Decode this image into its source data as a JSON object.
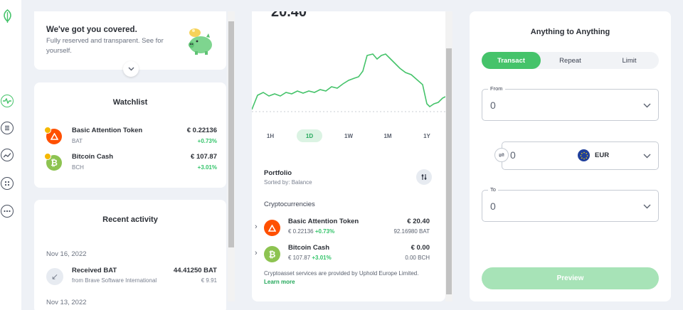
{
  "nav": {
    "icons": [
      "uphold-logo-icon",
      "activity-icon",
      "list-icon",
      "chart-icon",
      "dots-grid-icon",
      "more-icon"
    ]
  },
  "promo": {
    "title": "We've got you covered.",
    "text": "Fully reserved and transparent. See for yourself."
  },
  "watchlist": {
    "title": "Watchlist",
    "items": [
      {
        "name": "Basic Attention Token",
        "symbol": "BAT",
        "price": "€ 0.22136",
        "change": "+0.73%"
      },
      {
        "name": "Bitcoin Cash",
        "symbol": "BCH",
        "price": "€ 107.87",
        "change": "+3.01%"
      }
    ]
  },
  "recent": {
    "title": "Recent activity",
    "date1": "Nov 16, 2022",
    "activity": {
      "title": "Received BAT",
      "source": "from Brave Software International",
      "amount": "44.41250 BAT",
      "value": "€ 9.91"
    },
    "date2": "Nov 13, 2022"
  },
  "portfolio": {
    "value_top": "20.40",
    "ranges": [
      "1H",
      "1D",
      "1W",
      "1M",
      "1Y"
    ],
    "active_range": "1D",
    "title": "Portfolio",
    "sorted": "Sorted by: Balance",
    "category": "Cryptocurrencies",
    "rows": [
      {
        "name": "Basic Attention Token",
        "price": "€ 0.22136",
        "change": "+0.73%",
        "value": "€ 20.40",
        "qty": "92.16980 BAT"
      },
      {
        "name": "Bitcoin Cash",
        "price": "€ 107.87",
        "change": "+3.01%",
        "value": "€ 0.00",
        "qty": "0.00 BCH"
      }
    ],
    "footer": "Cryptoasset services are provided by Uphold Europe Limited.",
    "learn_more": "Learn more"
  },
  "trade": {
    "title": "Anything to Anything",
    "tabs": [
      "Transact",
      "Repeat",
      "Limit"
    ],
    "from_label": "From",
    "from_value": "0",
    "amount_value": "0",
    "currency": "EUR",
    "to_label": "To",
    "to_value": "0",
    "preview_label": "Preview"
  },
  "colors": {
    "accent": "#45c36a",
    "positive": "#33c46a",
    "bat": "#ff5000",
    "bch": "#8dc351"
  }
}
